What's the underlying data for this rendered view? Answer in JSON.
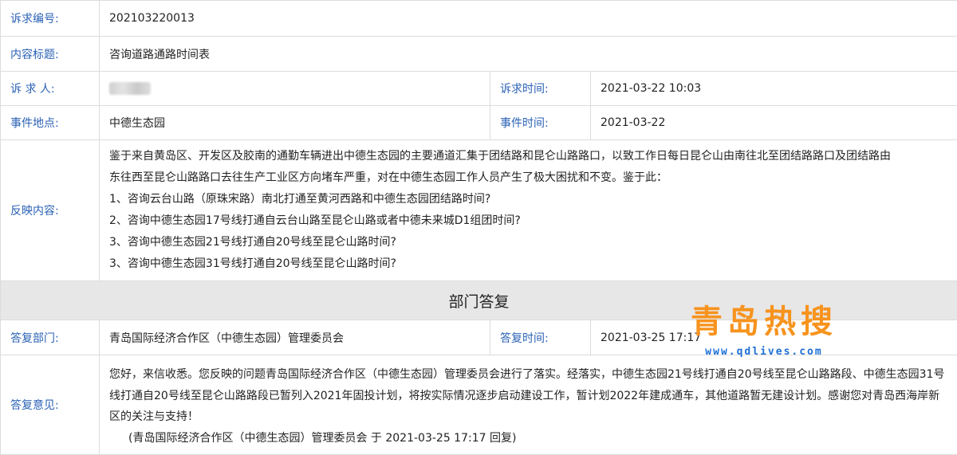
{
  "petition": {
    "id_label": "诉求编号:",
    "id_value": "202103220013",
    "title_label": "内容标题:",
    "title_value": "咨询道路通路时间表",
    "petitioner_label": "诉 求 人:",
    "time_label": "诉求时间:",
    "time_value": "2021-03-22 10:03",
    "location_label": "事件地点:",
    "location_value": "中德生态园",
    "event_time_label": "事件时间:",
    "event_time_value": "2021-03-22",
    "content_label": "反映内容:",
    "content_lines": [
      "鉴于来自黄岛区、开发区及胶南的通勤车辆进出中德生态园的主要通道汇集于团结路和昆仑山路路口，以致工作日每日昆仑山由南往北至团结路路口及团结路由",
      "东往西至昆仑山路路口去往生产工业区方向堵车严重，对在中德生态园工作人员产生了极大困扰和不变。鉴于此：",
      "1、咨询云台山路（原珠宋路）南北打通至黄河西路和中德生态园团结路时间?",
      "2、咨询中德生态园17号线打通自云台山路至昆仑山路或者中德未来城D1组团时间?",
      "3、咨询中德生态园21号线打通自20号线至昆仑山路时间?",
      "3、咨询中德生态园31号线打通自20号线至昆仑山路时间?"
    ]
  },
  "reply": {
    "section_title": "部门答复",
    "dept_label": "答复部门:",
    "dept_value": "青岛国际经济合作区（中德生态园）管理委员会",
    "time_label": "答复时间:",
    "time_value": "2021-03-25 17:17",
    "opinion_label": "答复意见:",
    "opinion_text": "您好，来信收悉。您反映的问题青岛国际经济合作区（中德生态园）管理委员会进行了落实。经落实，中德生态园21号线打通自20号线至昆仑山路路段、中德生态园31号线打通自20号线至昆仑山路路段已暂列入2021年固投计划，将按实际情况逐步启动建设工作，暂计划2022年建成通车，其他道路暂无建设计划。感谢您对青岛西海岸新区的关注与支持！",
    "signature": "(青岛国际经济合作区（中德生态园）管理委员会 于 2021-03-25 17:17 回复)"
  },
  "watermark": {
    "title": "青岛热搜",
    "url": "www.qdlives.com"
  }
}
